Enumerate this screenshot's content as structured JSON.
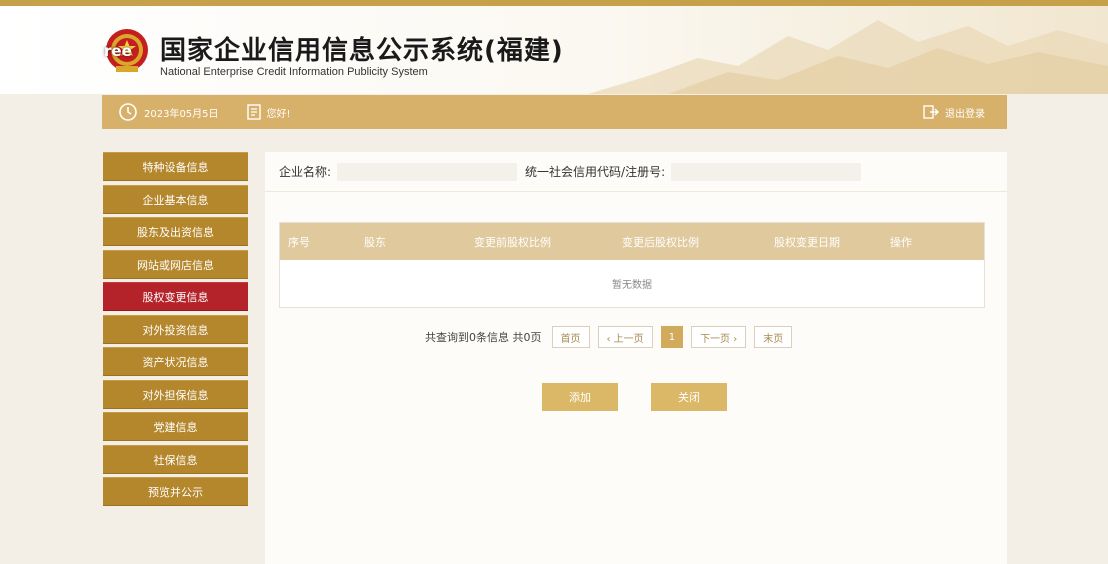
{
  "header": {
    "title": "国家企业信用信息公示系统(福建)",
    "subtitle": "National Enterprise Credit Information Publicity System",
    "watermark": "ree"
  },
  "info_bar": {
    "date": "2023年05月5日",
    "greeting": "您好!",
    "logout_label": "退出登录",
    "icons": {
      "date": "clock-icon",
      "user": "document-icon",
      "logout": "logout-icon"
    }
  },
  "sidebar": {
    "items": [
      {
        "label": "特种设备信息",
        "active": false
      },
      {
        "label": "企业基本信息",
        "active": false
      },
      {
        "label": "股东及出资信息",
        "active": false
      },
      {
        "label": "网站或网店信息",
        "active": false
      },
      {
        "label": "股权变更信息",
        "active": true
      },
      {
        "label": "对外投资信息",
        "active": false
      },
      {
        "label": "资产状况信息",
        "active": false
      },
      {
        "label": "对外担保信息",
        "active": false
      },
      {
        "label": "党建信息",
        "active": false
      },
      {
        "label": "社保信息",
        "active": false
      },
      {
        "label": "预览并公示",
        "active": false
      }
    ]
  },
  "search": {
    "company_name_label": "企业名称:",
    "company_name_value": "",
    "credit_code_label": "统一社会信用代码/注册号:",
    "credit_code_value": ""
  },
  "table": {
    "columns": [
      "序号",
      "股东",
      "变更前股权比例",
      "变更后股权比例",
      "股权变更日期",
      "操作"
    ],
    "empty_text": "暂无数据",
    "rows": []
  },
  "pagination": {
    "summary": "共查询到0条信息 共0页",
    "first": "首页",
    "prev": "‹ 上一页",
    "current": "1",
    "next": "下一页 ›",
    "last": "末页"
  },
  "actions": {
    "add": "添加",
    "close": "关闭"
  },
  "colors": {
    "accent": "#b5872d",
    "active": "#b4232a",
    "bar": "#d7b06a",
    "table_head": "#e0c99d",
    "button": "#dbb867"
  }
}
